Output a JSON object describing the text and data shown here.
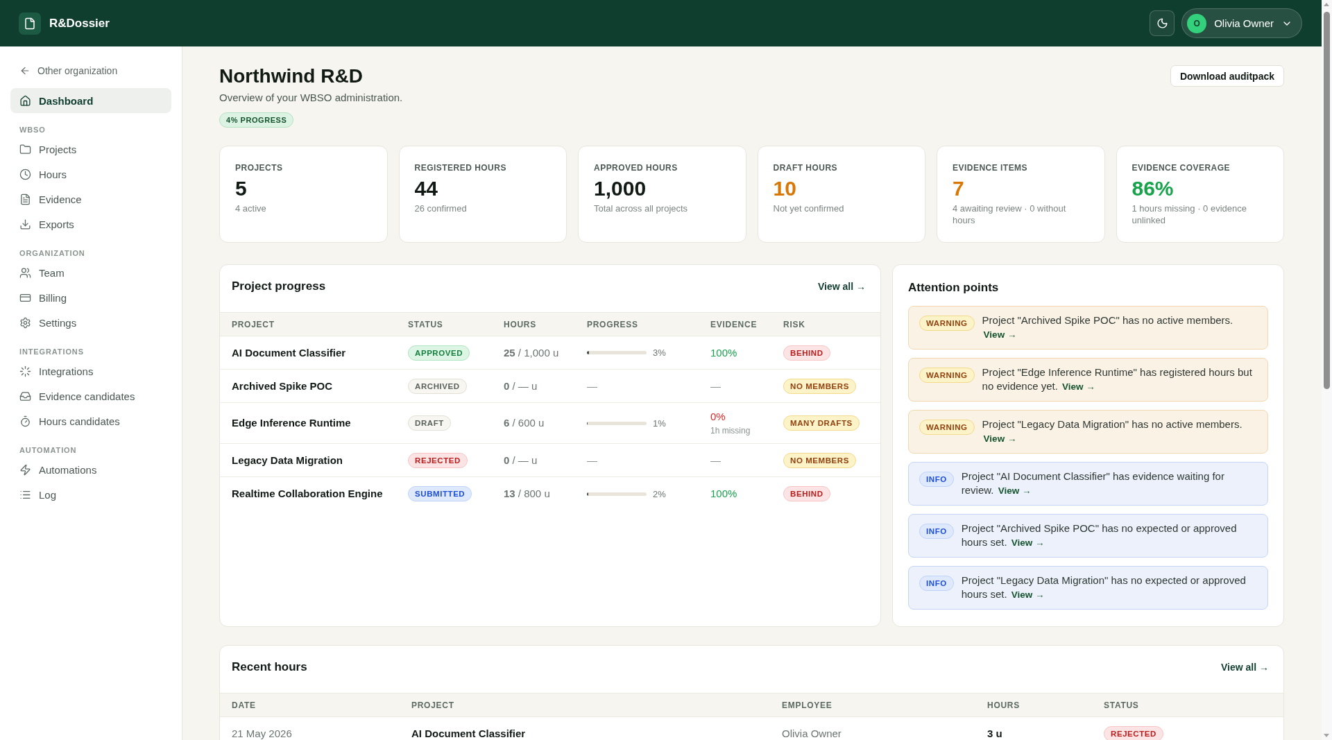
{
  "topbar": {
    "brand": "R&Dossier",
    "user": {
      "initial": "O",
      "name": "Olivia Owner"
    }
  },
  "sidebar": {
    "back_link": "Other organization",
    "items": [
      {
        "label": "Dashboard",
        "selected": true
      }
    ],
    "sections": [
      {
        "title": "WBSO",
        "items": [
          {
            "label": "Projects",
            "selected": false
          },
          {
            "label": "Hours",
            "selected": false
          },
          {
            "label": "Evidence",
            "selected": false
          },
          {
            "label": "Exports",
            "selected": false
          }
        ]
      },
      {
        "title": "ORGANIZATION",
        "items": [
          {
            "label": "Team",
            "selected": false
          },
          {
            "label": "Billing",
            "selected": false
          },
          {
            "label": "Settings",
            "selected": false
          }
        ]
      },
      {
        "title": "INTEGRATIONS",
        "items": [
          {
            "label": "Integrations",
            "selected": false
          },
          {
            "label": "Evidence candidates",
            "selected": false
          },
          {
            "label": "Hours candidates",
            "selected": false
          }
        ]
      },
      {
        "title": "AUTOMATION",
        "items": [
          {
            "label": "Automations",
            "selected": false
          },
          {
            "label": "Log",
            "selected": false
          }
        ]
      }
    ]
  },
  "header": {
    "title": "Northwind R&D",
    "subtitle": "Overview of your WBSO administration.",
    "progress_badge": "4% PROGRESS",
    "action": "Download auditpack"
  },
  "stats": [
    {
      "label": "PROJECTS",
      "value": "5",
      "note": "4 active",
      "color": "#111a15"
    },
    {
      "label": "REGISTERED HOURS",
      "value": "44",
      "note": "26 confirmed",
      "color": "#111a15"
    },
    {
      "label": "APPROVED HOURS",
      "value": "1,000",
      "note": "Total across all projects",
      "color": "#111a15"
    },
    {
      "label": "DRAFT HOURS",
      "value": "10",
      "note": "Not yet confirmed",
      "color": "#d97706"
    },
    {
      "label": "EVIDENCE ITEMS",
      "value": "7",
      "note": "4 awaiting review · 0 without hours",
      "color": "#d97706"
    },
    {
      "label": "EVIDENCE COVERAGE",
      "value": "86%",
      "note": "1 hours missing · 0 evidence unlinked",
      "color": "#16a34a"
    }
  ],
  "project_progress": {
    "title": "Project progress",
    "link": "View all →",
    "columns": [
      "PROJECT",
      "STATUS",
      "HOURS",
      "PROGRESS",
      "EVIDENCE",
      "RISK"
    ],
    "rows": [
      {
        "project": "AI Document Classifier",
        "status": {
          "label": "APPROVED",
          "color": "#15803d"
        },
        "hours": "**25** / 1,000 u",
        "progress": {
          "kind": "bar",
          "level": 0.03,
          "reading": "3%"
        },
        "evidence": {
          "value": "100%",
          "color": "#16a34a"
        },
        "risk": {
          "label": "BEHIND",
          "color": "#b91c1c"
        }
      },
      {
        "project": "Archived Spike POC",
        "status": {
          "label": "ARCHIVED",
          "color": "#5a615b"
        },
        "hours": "**0** / — u",
        "progress": {
          "kind": "empty",
          "reading": "—"
        },
        "evidence": {
          "value": "—",
          "color": "#8b958f"
        },
        "risk": {
          "label": "NO MEMBERS",
          "color": "#92400e"
        }
      },
      {
        "project": "Edge Inference Runtime",
        "status": {
          "label": "DRAFT",
          "color": "#5a615b"
        },
        "hours": "**6** / 600 u",
        "progress": {
          "kind": "bar",
          "level": 0.01,
          "reading": "1%"
        },
        "evidence": {
          "value": "0%",
          "color": "#dc2626",
          "note": "1h missing"
        },
        "risk": {
          "label": "MANY DRAFTS",
          "color": "#92400e"
        }
      },
      {
        "project": "Legacy Data Migration",
        "status": {
          "label": "REJECTED",
          "color": "#b91c1c"
        },
        "hours": "**0** / — u",
        "progress": {
          "kind": "empty",
          "reading": "—"
        },
        "evidence": {
          "value": "—",
          "color": "#8b958f"
        },
        "risk": {
          "label": "NO MEMBERS",
          "color": "#92400e"
        }
      },
      {
        "project": "Realtime Collaboration Engine",
        "status": {
          "label": "SUBMITTED",
          "color": "#1d4ed8"
        },
        "hours": "**13** / 800 u",
        "progress": {
          "kind": "bar",
          "level": 0.02,
          "reading": "2%"
        },
        "evidence": {
          "value": "100%",
          "color": "#16a34a"
        },
        "risk": {
          "label": "BEHIND",
          "color": "#b91c1c"
        }
      }
    ]
  },
  "attention_points": {
    "title": "Attention points",
    "items": [
      {
        "badge": "WARNING",
        "color": "#92400e",
        "text": "Project \"Archived Spike POC\" has no active members.",
        "link": "View →"
      },
      {
        "badge": "WARNING",
        "color": "#92400e",
        "text": "Project \"Edge Inference Runtime\" has registered hours but no evidence yet.",
        "link": "View →"
      },
      {
        "badge": "WARNING",
        "color": "#92400e",
        "text": "Project \"Legacy Data Migration\" has no active members.",
        "link": "View →"
      },
      {
        "badge": "INFO",
        "color": "#1d4ed8",
        "text": "Project \"AI Document Classifier\" has evidence waiting for review.",
        "link": "View →"
      },
      {
        "badge": "INFO",
        "color": "#1d4ed8",
        "text": "Project \"Archived Spike POC\" has no expected or approved hours set.",
        "link": "View →"
      },
      {
        "badge": "INFO",
        "color": "#1d4ed8",
        "text": "Project \"Legacy Data Migration\" has no expected or approved hours set.",
        "link": "View →"
      }
    ]
  },
  "recent_hours": {
    "title": "Recent hours",
    "link": "View all →",
    "columns": [
      "DATE",
      "PROJECT",
      "EMPLOYEE",
      "HOURS",
      "STATUS"
    ],
    "rows": [
      {
        "date": "21 May 2026",
        "project": "AI Document Classifier",
        "employee": "Olivia Owner",
        "hours": "3 u",
        "status": {
          "label": "REJECTED",
          "color": "#b91c1c"
        }
      }
    ]
  }
}
